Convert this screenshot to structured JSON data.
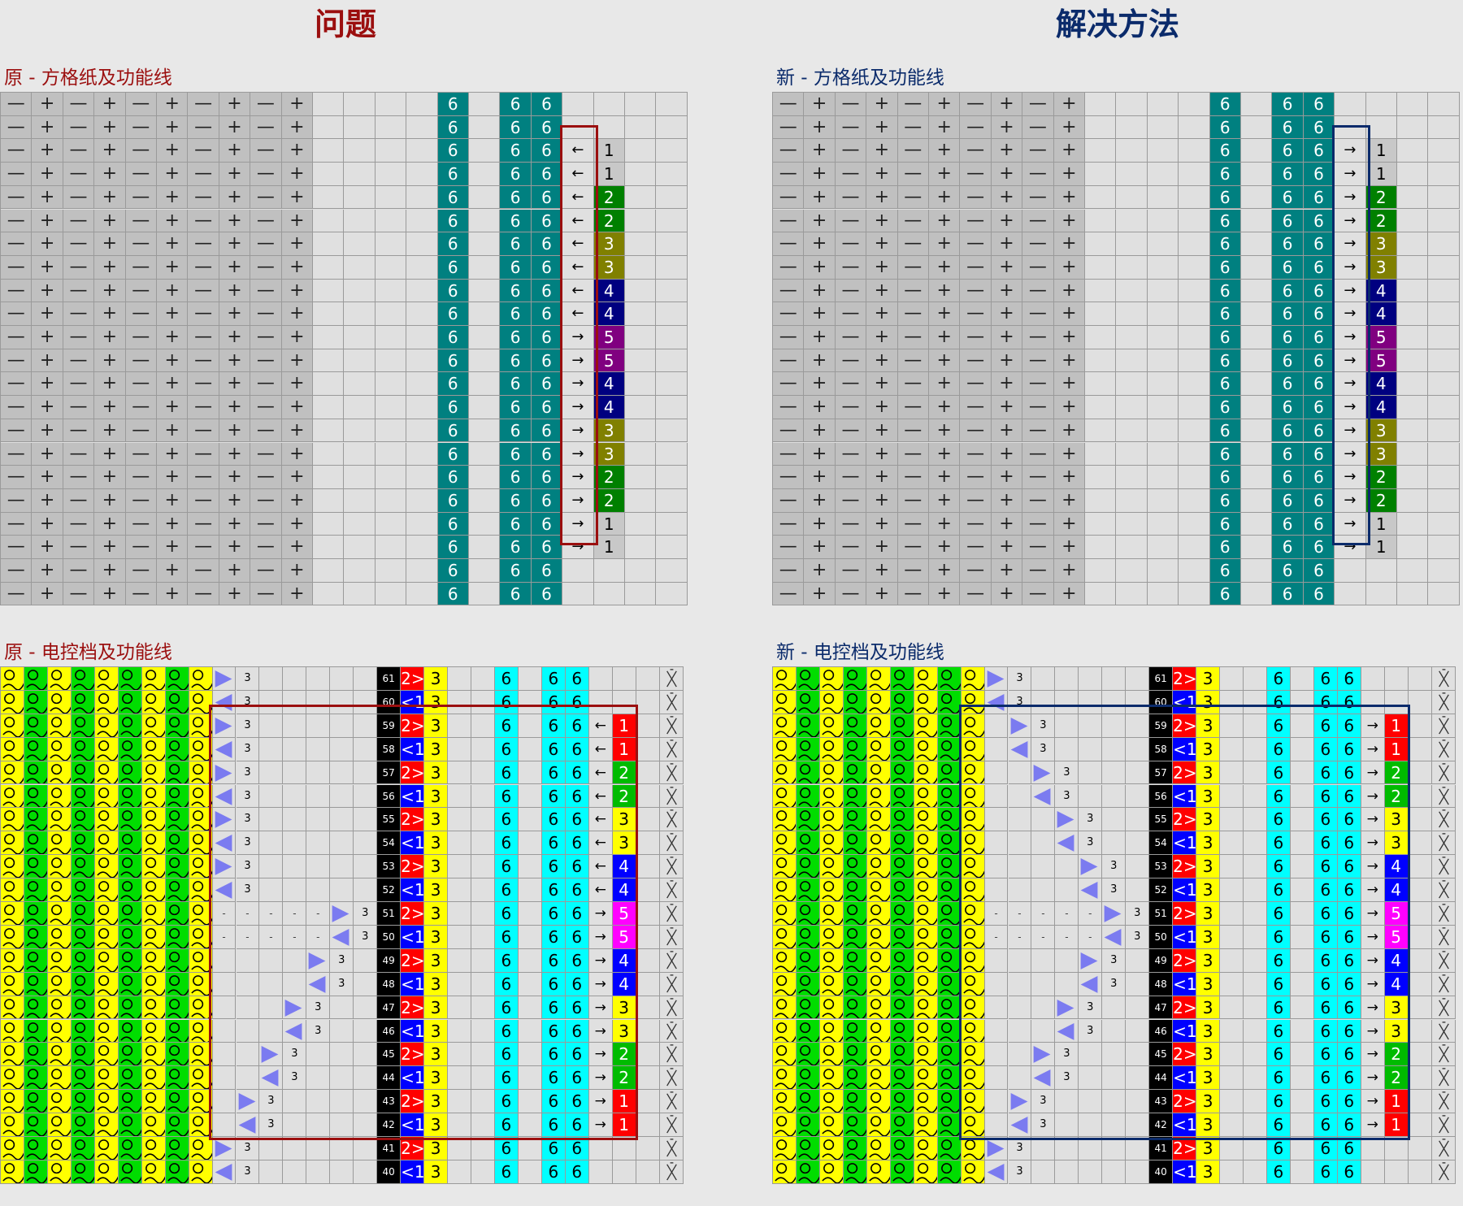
{
  "left": {
    "title": "问题",
    "grid_label": "原 - 方格纸及功能线",
    "cam_label": "原 - 电控档及功能线",
    "accent": "#9b0f0f",
    "arrow_dirs": [
      "←",
      "←",
      "←",
      "←",
      "←",
      "←",
      "←",
      "←",
      "→",
      "→",
      "→",
      "→",
      "→",
      "→",
      "→",
      "→"
    ]
  },
  "right": {
    "title": "解决方法",
    "grid_label": "新 - 方格纸及功能线",
    "cam_label": "新 - 电控档及功能线",
    "accent": "#0b2b6b",
    "arrow_dirs": [
      "→",
      "→",
      "→",
      "→",
      "→",
      "→",
      "→",
      "→",
      "→",
      "→",
      "→",
      "→",
      "→",
      "→",
      "→",
      "→"
    ]
  },
  "grid": {
    "pattern": [
      "—",
      "+",
      "—",
      "+",
      "—",
      "+",
      "—",
      "+",
      "—",
      "+"
    ],
    "col_values": [
      "6",
      "6",
      "6"
    ],
    "func_values": [
      "1",
      "1",
      "2",
      "2",
      "3",
      "3",
      "4",
      "4",
      "5",
      "5",
      "4",
      "4",
      "3",
      "3",
      "2",
      "2",
      "1",
      "1"
    ]
  },
  "cam": {
    "row_numbers": [
      "61",
      "60",
      "59",
      "58",
      "57",
      "56",
      "55",
      "54",
      "53",
      "52",
      "51",
      "50",
      "49",
      "48",
      "47",
      "46",
      "45",
      "44",
      "43",
      "42",
      "41",
      "40"
    ],
    "dir_odd": "2>",
    "dir_even": "<1",
    "three": "3",
    "six": "6",
    "dash": "-",
    "func_values": [
      "1",
      "1",
      "2",
      "2",
      "3",
      "3",
      "4",
      "4",
      "5",
      "5",
      "4",
      "4",
      "3",
      "3",
      "2",
      "2",
      "1",
      "1"
    ]
  },
  "colors": {
    "teal": "#008080",
    "cyan": "#00ffff",
    "yellow": "#ffff00",
    "green": "#00dd00",
    "red_dir": "#ff0000",
    "blue_dir": "#0000ff",
    "grid_func": [
      "#c8c8c8",
      "#c8c8c8",
      "#008000",
      "#008000",
      "#808000",
      "#808000",
      "#000080",
      "#000080",
      "#800080",
      "#800080",
      "#000080",
      "#000080",
      "#808000",
      "#808000",
      "#008000",
      "#008000",
      "#c8c8c8",
      "#c8c8c8"
    ],
    "cam_func": [
      "#ff0000",
      "#ff0000",
      "#00bb00",
      "#00bb00",
      "#ffff00",
      "#ffff00",
      "#0000ff",
      "#0000ff",
      "#ff00ff",
      "#ff00ff",
      "#0000ff",
      "#0000ff",
      "#ffff00",
      "#ffff00",
      "#00bb00",
      "#00bb00",
      "#ff0000",
      "#ff0000"
    ]
  }
}
